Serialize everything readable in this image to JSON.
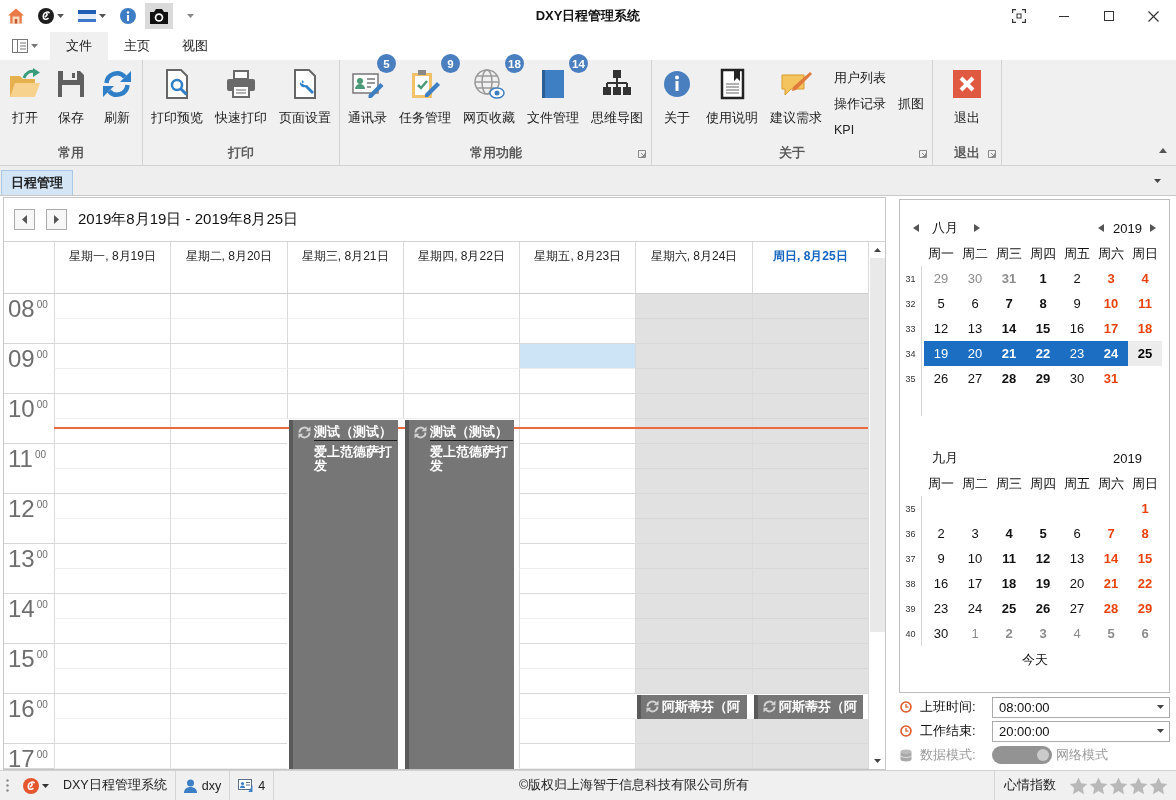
{
  "window": {
    "title": "DXY日程管理系统"
  },
  "quick_access": [
    {
      "dropdown": false,
      "highlighted": false
    },
    {
      "dropdown": true,
      "highlighted": false
    },
    {
      "dropdown": true,
      "highlighted": false
    },
    {
      "dropdown": false,
      "highlighted": false
    },
    {
      "dropdown": false,
      "highlighted": true
    }
  ],
  "ribbon": {
    "tabs": [
      {
        "label": "文件",
        "selected": true
      },
      {
        "label": "主页",
        "selected": false
      },
      {
        "label": "视图",
        "selected": false
      }
    ],
    "groups": [
      {
        "label": "常用",
        "launcher": false,
        "items": [
          {
            "kind": "large",
            "label": "打开"
          },
          {
            "kind": "large",
            "label": "保存"
          },
          {
            "kind": "large",
            "label": "刷新"
          }
        ]
      },
      {
        "label": "打印",
        "launcher": false,
        "items": [
          {
            "kind": "large",
            "label": "打印预览"
          },
          {
            "kind": "large",
            "label": "快速打印"
          },
          {
            "kind": "large",
            "label": "页面设置"
          }
        ]
      },
      {
        "label": "常用功能",
        "launcher": true,
        "items": [
          {
            "kind": "large",
            "label": "通讯录",
            "badge": "5"
          },
          {
            "kind": "large",
            "label": "任务管理",
            "badge": "9"
          },
          {
            "kind": "large",
            "label": "网页收藏",
            "badge": "18"
          },
          {
            "kind": "large",
            "label": "文件管理",
            "badge": "14"
          },
          {
            "kind": "large",
            "label": "思维导图"
          }
        ]
      },
      {
        "label": "关于",
        "launcher": true,
        "items": [
          {
            "kind": "large",
            "label": "关于"
          },
          {
            "kind": "large",
            "label": "使用说明"
          },
          {
            "kind": "large",
            "label": "建议需求"
          },
          {
            "kind": "stack",
            "labels": [
              "用户列表",
              "操作记录",
              "KPI"
            ]
          },
          {
            "kind": "stack",
            "labels": [
              "抓图"
            ]
          }
        ]
      },
      {
        "label": "退出",
        "launcher": true,
        "items": [
          {
            "kind": "large",
            "label": "退出"
          }
        ]
      }
    ]
  },
  "doc_tabs": [
    {
      "label": "日程管理",
      "selected": true
    }
  ],
  "scheduler": {
    "range": "2019年8月19日 - 2019年8月25日",
    "rows": [
      {
        "hour": "08",
        "minutes": "00",
        "now": false
      },
      {
        "now": false
      },
      {
        "hour": "09",
        "minutes": "00",
        "now": false
      },
      {
        "now": false
      },
      {
        "hour": "10",
        "minutes": "00",
        "now": false
      },
      {
        "now": true
      },
      {
        "hour": "11",
        "minutes": "00",
        "now": false
      },
      {
        "now": false
      },
      {
        "hour": "12",
        "minutes": "00",
        "now": false
      },
      {
        "now": false
      },
      {
        "hour": "13",
        "minutes": "00",
        "now": false
      },
      {
        "now": false
      },
      {
        "hour": "14",
        "minutes": "00",
        "now": false
      },
      {
        "now": false
      },
      {
        "hour": "15",
        "minutes": "00",
        "now": false
      },
      {
        "now": false
      },
      {
        "hour": "16",
        "minutes": "00",
        "now": false
      },
      {
        "now": false
      },
      {
        "hour": "17",
        "minutes": "00",
        "now": false
      }
    ],
    "days": [
      {
        "label": "星期一, 8月19日",
        "today": false,
        "workday": true,
        "slots": [
          {
            "kind": "slot",
            "selected": false
          },
          {
            "kind": "slot",
            "selected": false
          },
          {
            "kind": "slot",
            "selected": false
          },
          {
            "kind": "slot",
            "selected": false
          },
          {
            "kind": "slot",
            "selected": false
          },
          {
            "kind": "slot",
            "selected": false
          },
          {
            "kind": "slot",
            "selected": false
          },
          {
            "kind": "slot",
            "selected": false
          },
          {
            "kind": "slot",
            "selected": false
          },
          {
            "kind": "slot",
            "selected": false
          },
          {
            "kind": "slot",
            "selected": false
          },
          {
            "kind": "slot",
            "selected": false
          },
          {
            "kind": "slot",
            "selected": false
          },
          {
            "kind": "slot",
            "selected": false
          },
          {
            "kind": "slot",
            "selected": false
          },
          {
            "kind": "slot",
            "selected": false
          },
          {
            "kind": "slot",
            "selected": false
          },
          {
            "kind": "slot",
            "selected": false
          },
          {
            "kind": "slot",
            "selected": false
          }
        ]
      },
      {
        "label": "星期二, 8月20日",
        "today": false,
        "workday": true,
        "slots": [
          {
            "kind": "slot",
            "selected": false
          },
          {
            "kind": "slot",
            "selected": false
          },
          {
            "kind": "slot",
            "selected": false
          },
          {
            "kind": "slot",
            "selected": false
          },
          {
            "kind": "slot",
            "selected": false
          },
          {
            "kind": "slot",
            "selected": false
          },
          {
            "kind": "slot",
            "selected": false
          },
          {
            "kind": "slot",
            "selected": false
          },
          {
            "kind": "slot",
            "selected": false
          },
          {
            "kind": "slot",
            "selected": false
          },
          {
            "kind": "slot",
            "selected": false
          },
          {
            "kind": "slot",
            "selected": false
          },
          {
            "kind": "slot",
            "selected": false
          },
          {
            "kind": "slot",
            "selected": false
          },
          {
            "kind": "slot",
            "selected": false
          },
          {
            "kind": "slot",
            "selected": false
          },
          {
            "kind": "slot",
            "selected": false
          },
          {
            "kind": "slot",
            "selected": false
          },
          {
            "kind": "slot",
            "selected": false
          }
        ]
      },
      {
        "label": "星期三, 8月21日",
        "today": false,
        "workday": true,
        "slots": [
          {
            "kind": "slot",
            "selected": false
          },
          {
            "kind": "slot",
            "selected": false
          },
          {
            "kind": "slot",
            "selected": false
          },
          {
            "kind": "slot",
            "selected": false
          },
          {
            "kind": "slot",
            "selected": false
          },
          {
            "kind": "event",
            "selected": false,
            "title": "测试（测试）",
            "description": "爱上范德萨打发",
            "recurring": true,
            "until_end": true
          }
        ]
      },
      {
        "label": "星期四, 8月22日",
        "today": false,
        "workday": true,
        "slots": [
          {
            "kind": "slot",
            "selected": false
          },
          {
            "kind": "slot",
            "selected": false
          },
          {
            "kind": "slot",
            "selected": false
          },
          {
            "kind": "slot",
            "selected": false
          },
          {
            "kind": "slot",
            "selected": false
          },
          {
            "kind": "event",
            "selected": false,
            "title": "测试（测试）",
            "description": "爱上范德萨打发",
            "recurring": true,
            "until_end": true
          }
        ]
      },
      {
        "label": "星期五, 8月23日",
        "today": false,
        "workday": true,
        "slots": [
          {
            "kind": "slot",
            "selected": false
          },
          {
            "kind": "slot",
            "selected": false
          },
          {
            "kind": "slot",
            "selected": true
          },
          {
            "kind": "slot",
            "selected": false
          },
          {
            "kind": "slot",
            "selected": false
          },
          {
            "kind": "slot",
            "selected": false
          },
          {
            "kind": "slot",
            "selected": false
          },
          {
            "kind": "slot",
            "selected": false
          },
          {
            "kind": "slot",
            "selected": false
          },
          {
            "kind": "slot",
            "selected": false
          },
          {
            "kind": "slot",
            "selected": false
          },
          {
            "kind": "slot",
            "selected": false
          },
          {
            "kind": "slot",
            "selected": false
          },
          {
            "kind": "slot",
            "selected": false
          },
          {
            "kind": "slot",
            "selected": false
          },
          {
            "kind": "slot",
            "selected": false
          },
          {
            "kind": "slot",
            "selected": false
          },
          {
            "kind": "slot",
            "selected": false
          },
          {
            "kind": "slot",
            "selected": false
          }
        ]
      },
      {
        "label": "星期六, 8月24日",
        "today": false,
        "workday": false,
        "slots": [
          {
            "kind": "slot",
            "selected": false
          },
          {
            "kind": "slot",
            "selected": false
          },
          {
            "kind": "slot",
            "selected": false
          },
          {
            "kind": "slot",
            "selected": false
          },
          {
            "kind": "slot",
            "selected": false
          },
          {
            "kind": "slot",
            "selected": false
          },
          {
            "kind": "slot",
            "selected": false
          },
          {
            "kind": "slot",
            "selected": false
          },
          {
            "kind": "slot",
            "selected": false
          },
          {
            "kind": "slot",
            "selected": false
          },
          {
            "kind": "slot",
            "selected": false
          },
          {
            "kind": "slot",
            "selected": false
          },
          {
            "kind": "slot",
            "selected": false
          },
          {
            "kind": "slot",
            "selected": false
          },
          {
            "kind": "slot",
            "selected": false
          },
          {
            "kind": "slot",
            "selected": false
          },
          {
            "kind": "event",
            "selected": false,
            "title": "阿斯蒂芬（阿",
            "recurring": true,
            "until_end": false
          },
          {
            "kind": "slot",
            "selected": false
          },
          {
            "kind": "slot",
            "selected": false
          }
        ]
      },
      {
        "label": "周日, 8月25日",
        "today": true,
        "workday": false,
        "slots": [
          {
            "kind": "slot",
            "selected": false
          },
          {
            "kind": "slot",
            "selected": false
          },
          {
            "kind": "slot",
            "selected": false
          },
          {
            "kind": "slot",
            "selected": false
          },
          {
            "kind": "slot",
            "selected": false
          },
          {
            "kind": "slot",
            "selected": false
          },
          {
            "kind": "slot",
            "selected": false
          },
          {
            "kind": "slot",
            "selected": false
          },
          {
            "kind": "slot",
            "selected": false
          },
          {
            "kind": "slot",
            "selected": false
          },
          {
            "kind": "slot",
            "selected": false
          },
          {
            "kind": "slot",
            "selected": false
          },
          {
            "kind": "slot",
            "selected": false
          },
          {
            "kind": "slot",
            "selected": false
          },
          {
            "kind": "slot",
            "selected": false
          },
          {
            "kind": "slot",
            "selected": false
          },
          {
            "kind": "event",
            "selected": false,
            "title": "阿斯蒂芬（阿",
            "recurring": true,
            "until_end": false
          },
          {
            "kind": "slot",
            "selected": false
          },
          {
            "kind": "slot",
            "selected": false
          }
        ]
      }
    ]
  },
  "mini_calendar": {
    "months": [
      {
        "month": "八月",
        "year": "2019",
        "nav": true,
        "weekdays": [
          "周一",
          "周二",
          "周三",
          "周四",
          "周五",
          "周六",
          "周日"
        ],
        "weeks": [
          {
            "week": "31",
            "days": [
              {
                "text": "29",
                "kind": "muted",
                "bold": false,
                "selected": false,
                "today": false
              },
              {
                "text": "30",
                "kind": "muted",
                "bold": false,
                "selected": false,
                "today": false
              },
              {
                "text": "31",
                "kind": "muted",
                "bold": true,
                "selected": false,
                "today": false
              },
              {
                "text": "1",
                "kind": "plain",
                "bold": true,
                "selected": false,
                "today": false
              },
              {
                "text": "2",
                "kind": "plain",
                "bold": false,
                "selected": false,
                "today": false
              },
              {
                "text": "3",
                "kind": "weekend",
                "bold": true,
                "selected": false,
                "today": false
              },
              {
                "text": "4",
                "kind": "weekend",
                "bold": true,
                "selected": false,
                "today": false
              }
            ]
          },
          {
            "week": "32",
            "days": [
              {
                "text": "5",
                "kind": "plain",
                "bold": false,
                "selected": false,
                "today": false
              },
              {
                "text": "6",
                "kind": "plain",
                "bold": false,
                "selected": false,
                "today": false
              },
              {
                "text": "7",
                "kind": "plain",
                "bold": true,
                "selected": false,
                "today": false
              },
              {
                "text": "8",
                "kind": "plain",
                "bold": true,
                "selected": false,
                "today": false
              },
              {
                "text": "9",
                "kind": "plain",
                "bold": false,
                "selected": false,
                "today": false
              },
              {
                "text": "10",
                "kind": "weekend",
                "bold": true,
                "selected": false,
                "today": false
              },
              {
                "text": "11",
                "kind": "weekend",
                "bold": true,
                "selected": false,
                "today": false
              }
            ]
          },
          {
            "week": "33",
            "days": [
              {
                "text": "12",
                "kind": "plain",
                "bold": false,
                "selected": false,
                "today": false
              },
              {
                "text": "13",
                "kind": "plain",
                "bold": false,
                "selected": false,
                "today": false
              },
              {
                "text": "14",
                "kind": "plain",
                "bold": true,
                "selected": false,
                "today": false
              },
              {
                "text": "15",
                "kind": "plain",
                "bold": true,
                "selected": false,
                "today": false
              },
              {
                "text": "16",
                "kind": "plain",
                "bold": false,
                "selected": false,
                "today": false
              },
              {
                "text": "17",
                "kind": "weekend",
                "bold": true,
                "selected": false,
                "today": false
              },
              {
                "text": "18",
                "kind": "weekend",
                "bold": true,
                "selected": false,
                "today": false
              }
            ]
          },
          {
            "week": "34",
            "days": [
              {
                "text": "19",
                "kind": "plain",
                "bold": false,
                "selected": true,
                "today": false
              },
              {
                "text": "20",
                "kind": "plain",
                "bold": false,
                "selected": true,
                "today": false
              },
              {
                "text": "21",
                "kind": "plain",
                "bold": true,
                "selected": true,
                "today": false
              },
              {
                "text": "22",
                "kind": "plain",
                "bold": true,
                "selected": true,
                "today": false
              },
              {
                "text": "23",
                "kind": "plain",
                "bold": false,
                "selected": true,
                "today": false
              },
              {
                "text": "24",
                "kind": "weekend",
                "bold": true,
                "selected": true,
                "today": false
              },
              {
                "text": "25",
                "kind": "weekend",
                "bold": true,
                "selected": false,
                "today": true
              }
            ]
          },
          {
            "week": "35",
            "days": [
              {
                "text": "26",
                "kind": "plain",
                "bold": false,
                "selected": false,
                "today": false
              },
              {
                "text": "27",
                "kind": "plain",
                "bold": false,
                "selected": false,
                "today": false
              },
              {
                "text": "28",
                "kind": "plain",
                "bold": true,
                "selected": false,
                "today": false
              },
              {
                "text": "29",
                "kind": "plain",
                "bold": true,
                "selected": false,
                "today": false
              },
              {
                "text": "30",
                "kind": "plain",
                "bold": false,
                "selected": false,
                "today": false
              },
              {
                "text": "31",
                "kind": "weekend",
                "bold": true,
                "selected": false,
                "today": false
              }
            ]
          }
        ]
      },
      {
        "month": "九月",
        "year": "2019",
        "nav": false,
        "weekdays": [
          "周一",
          "周二",
          "周三",
          "周四",
          "周五",
          "周六",
          "周日"
        ],
        "weeks": [
          {
            "week": "35",
            "days": [
              {
                "text": "1",
                "kind": "weekend",
                "bold": true,
                "selected": false,
                "today": false
              }
            ]
          },
          {
            "week": "36",
            "days": [
              {
                "text": "2",
                "kind": "plain",
                "bold": false,
                "selected": false,
                "today": false
              },
              {
                "text": "3",
                "kind": "plain",
                "bold": false,
                "selected": false,
                "today": false
              },
              {
                "text": "4",
                "kind": "plain",
                "bold": true,
                "selected": false,
                "today": false
              },
              {
                "text": "5",
                "kind": "plain",
                "bold": true,
                "selected": false,
                "today": false
              },
              {
                "text": "6",
                "kind": "plain",
                "bold": false,
                "selected": false,
                "today": false
              },
              {
                "text": "7",
                "kind": "weekend",
                "bold": true,
                "selected": false,
                "today": false
              },
              {
                "text": "8",
                "kind": "weekend",
                "bold": true,
                "selected": false,
                "today": false
              }
            ]
          },
          {
            "week": "37",
            "days": [
              {
                "text": "9",
                "kind": "plain",
                "bold": false,
                "selected": false,
                "today": false
              },
              {
                "text": "10",
                "kind": "plain",
                "bold": false,
                "selected": false,
                "today": false
              },
              {
                "text": "11",
                "kind": "plain",
                "bold": true,
                "selected": false,
                "today": false
              },
              {
                "text": "12",
                "kind": "plain",
                "bold": true,
                "selected": false,
                "today": false
              },
              {
                "text": "13",
                "kind": "plain",
                "bold": false,
                "selected": false,
                "today": false
              },
              {
                "text": "14",
                "kind": "weekend",
                "bold": true,
                "selected": false,
                "today": false
              },
              {
                "text": "15",
                "kind": "weekend",
                "bold": true,
                "selected": false,
                "today": false
              }
            ]
          },
          {
            "week": "38",
            "days": [
              {
                "text": "16",
                "kind": "plain",
                "bold": false,
                "selected": false,
                "today": false
              },
              {
                "text": "17",
                "kind": "plain",
                "bold": false,
                "selected": false,
                "today": false
              },
              {
                "text": "18",
                "kind": "plain",
                "bold": true,
                "selected": false,
                "today": false
              },
              {
                "text": "19",
                "kind": "plain",
                "bold": true,
                "selected": false,
                "today": false
              },
              {
                "text": "20",
                "kind": "plain",
                "bold": false,
                "selected": false,
                "today": false
              },
              {
                "text": "21",
                "kind": "weekend",
                "bold": true,
                "selected": false,
                "today": false
              },
              {
                "text": "22",
                "kind": "weekend",
                "bold": true,
                "selected": false,
                "today": false
              }
            ]
          },
          {
            "week": "39",
            "days": [
              {
                "text": "23",
                "kind": "plain",
                "bold": false,
                "selected": false,
                "today": false
              },
              {
                "text": "24",
                "kind": "plain",
                "bold": false,
                "selected": false,
                "today": false
              },
              {
                "text": "25",
                "kind": "plain",
                "bold": true,
                "selected": false,
                "today": false
              },
              {
                "text": "26",
                "kind": "plain",
                "bold": true,
                "selected": false,
                "today": false
              },
              {
                "text": "27",
                "kind": "plain",
                "bold": false,
                "selected": false,
                "today": false
              },
              {
                "text": "28",
                "kind": "weekend",
                "bold": true,
                "selected": false,
                "today": false
              },
              {
                "text": "29",
                "kind": "weekend",
                "bold": true,
                "selected": false,
                "today": false
              }
            ]
          },
          {
            "week": "40",
            "days": [
              {
                "text": "30",
                "kind": "plain",
                "bold": false,
                "selected": false,
                "today": false
              },
              {
                "text": "1",
                "kind": "muted",
                "bold": false,
                "selected": false,
                "today": false
              },
              {
                "text": "2",
                "kind": "muted",
                "bold": true,
                "selected": false,
                "today": false
              },
              {
                "text": "3",
                "kind": "muted",
                "bold": true,
                "selected": false,
                "today": false
              },
              {
                "text": "4",
                "kind": "muted",
                "bold": false,
                "selected": false,
                "today": false
              },
              {
                "text": "5",
                "kind": "muted",
                "bold": true,
                "selected": false,
                "today": false
              },
              {
                "text": "6",
                "kind": "muted",
                "bold": true,
                "selected": false,
                "today": false
              }
            ]
          }
        ]
      }
    ],
    "today_button": "今天"
  },
  "settings": {
    "fields": [
      {
        "label": "上班时间:",
        "value": "08:00:00"
      },
      {
        "label": "工作结束:",
        "value": "20:00:00"
      }
    ],
    "data_mode": {
      "label": "数据模式:",
      "option": "网络模式",
      "on": true,
      "disabled": true
    }
  },
  "status_bar": {
    "app_name": "DXY日程管理系统",
    "user": "dxy",
    "contacts": "4",
    "copyright": "©版权归上海智于信息科技有限公司所有",
    "mood_label": "心情指数",
    "stars": 0
  }
}
